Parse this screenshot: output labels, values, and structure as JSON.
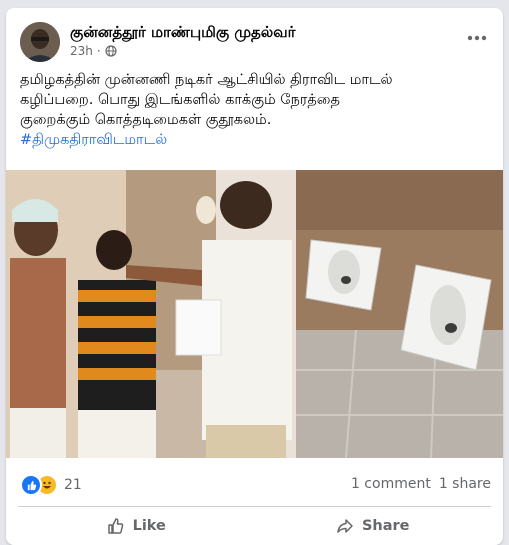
{
  "post": {
    "page_name": "குன்னத்தூர் மாண்புமிகு முதல்வர்",
    "timestamp": "23h",
    "privacy_icon": "globe-icon",
    "text_lines": [
      "தமிழகத்தின் முன்னணி நடிகர் ஆட்சியில் திராவிட மாடல்",
      "கழிப்பறை. பொது இடங்களில் காக்கும் நேரத்தை",
      "குறைக்கும் கொத்தடிமைகள் குதூகலம்."
    ],
    "hashtag": "#திமுகதிராவிடமாடல்"
  },
  "stats": {
    "reaction_icons": [
      "like-icon",
      "haha-icon"
    ],
    "reaction_count": "21",
    "comments": "1 comment",
    "shares": "1 share"
  },
  "actions": {
    "like_label": "Like",
    "share_label": "Share"
  },
  "colors": {
    "accent": "#1877f2",
    "hashtag": "#216fdb",
    "secondary_text": "#65676b"
  }
}
